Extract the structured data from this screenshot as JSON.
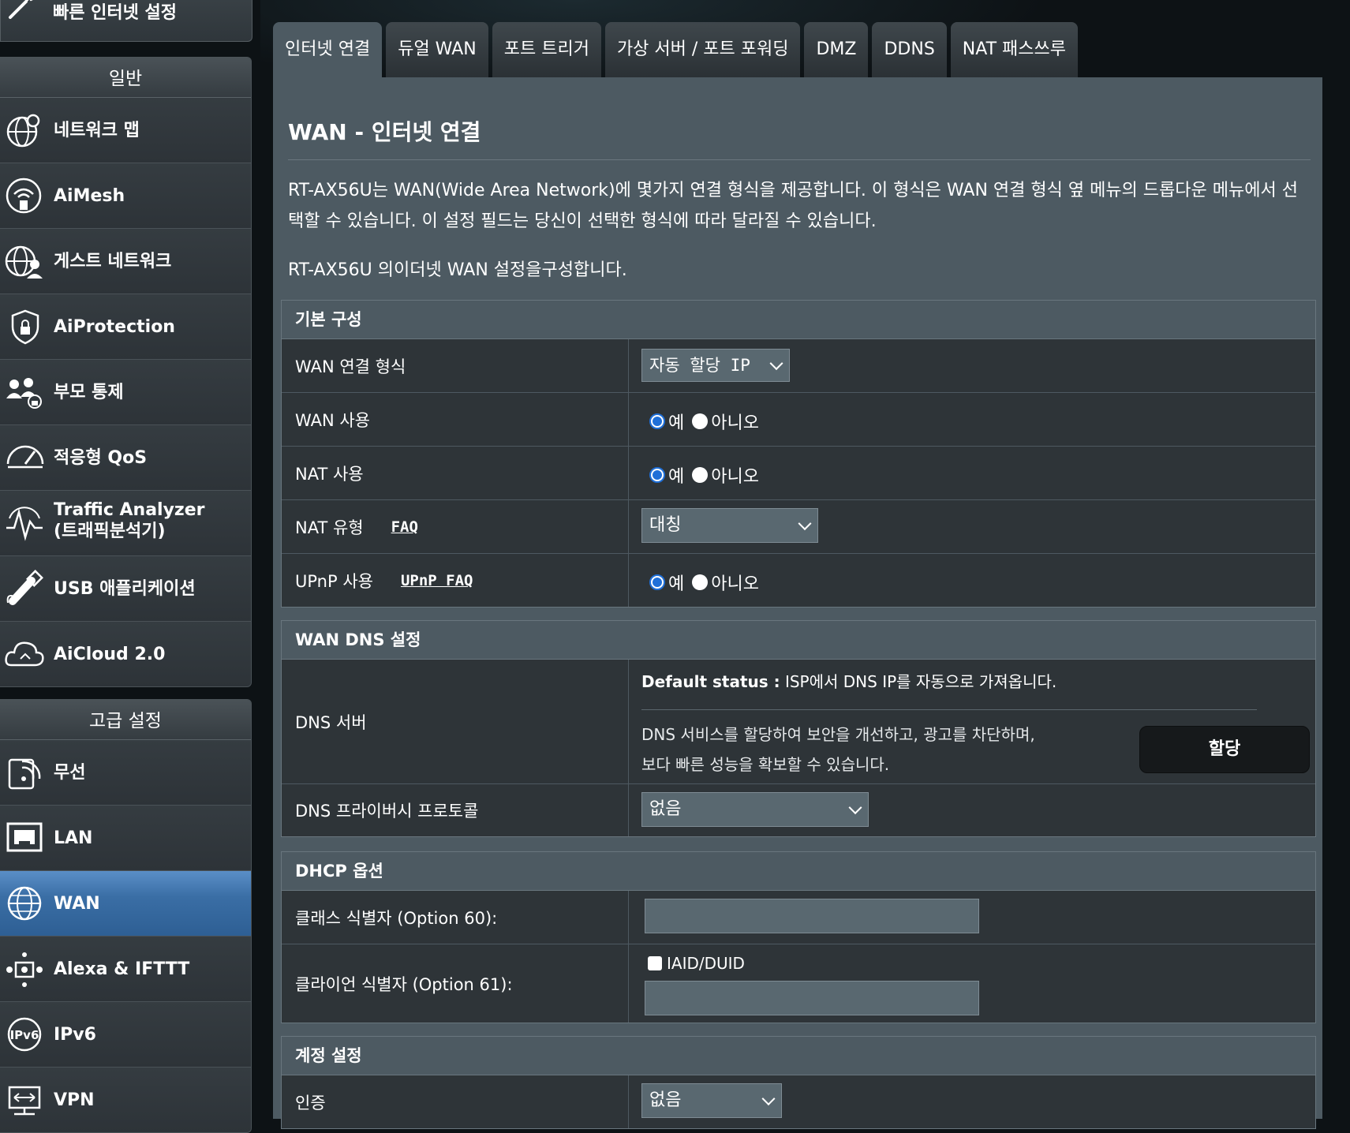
{
  "sidebar": {
    "quick_setup": "빠른 인터넷 설정",
    "general_header": "일반",
    "general_items": [
      {
        "label": "네트워크 맵",
        "icon": "globe-pin-icon"
      },
      {
        "label": "AiMesh",
        "icon": "aimesh-icon"
      },
      {
        "label": "게스트 네트워크",
        "icon": "guest-network-icon"
      },
      {
        "label": "AiProtection",
        "icon": "shield-lock-icon"
      },
      {
        "label": "부모 통제",
        "icon": "parental-control-icon"
      },
      {
        "label": "적응형 QoS",
        "icon": "speedometer-icon"
      },
      {
        "label": "Traffic Analyzer",
        "label2": "(트래픽분석기)",
        "icon": "traffic-analyzer-icon"
      },
      {
        "label": "USB 애플리케이션",
        "icon": "usb-icon"
      },
      {
        "label": "AiCloud 2.0",
        "icon": "cloud-icon"
      }
    ],
    "advanced_header": "고급 설정",
    "advanced_items": [
      {
        "label": "무선",
        "icon": "wireless-icon"
      },
      {
        "label": "LAN",
        "icon": "lan-icon"
      },
      {
        "label": "WAN",
        "icon": "wan-globe-icon",
        "active": true
      },
      {
        "label": "Alexa & IFTTT",
        "icon": "alexa-icon"
      },
      {
        "label": "IPv6",
        "icon": "ipv6-icon"
      },
      {
        "label": "VPN",
        "icon": "vpn-icon"
      }
    ]
  },
  "tabs": [
    "인터넷 연결",
    "듀얼 WAN",
    "포트 트리거",
    "가상 서버 / 포트 포워딩",
    "DMZ",
    "DDNS",
    "NAT 패스쓰루"
  ],
  "page": {
    "title": "WAN - 인터넷 연결",
    "description": "RT-AX56U는 WAN(Wide Area Network)에 몇가지 연결 형식을 제공합니다. 이 형식은 WAN 연결 형식 옆 메뉴의 드롭다운 메뉴에서 선택할 수 있습니다. 이 설정 필드는 당신이 선택한 형식에 따라 달라질 수 있습니다.",
    "description2": "RT-AX56U 의이더넷 WAN 설정을구성합니다."
  },
  "basic": {
    "header": "기본 구성",
    "wan_type_label": "WAN 연결 형식",
    "wan_type_value": "자동 할당 IP",
    "wan_enable_label": "WAN 사용",
    "nat_enable_label": "NAT 사용",
    "nat_type_label": "NAT 유형",
    "nat_type_faq": "FAQ",
    "nat_type_value": "대칭",
    "upnp_label": "UPnP 사용",
    "upnp_faq": "UPnP FAQ",
    "yes": "예",
    "no": "아니오"
  },
  "dns": {
    "header": "WAN DNS 설정",
    "server_label": "DNS 서버",
    "default_status_label": "Default status :",
    "default_status_text": " ISP에서 DNS IP를 자동으로 가져옵니다.",
    "assign_desc_line1": "DNS 서비스를 할당하여 보안을 개선하고, 광고를 차단하며,",
    "assign_desc_line2": "보다 빠른 성능을 확보할 수 있습니다.",
    "assign_button": "할당",
    "privacy_label": "DNS 프라이버시 프로토콜",
    "privacy_value": "없음"
  },
  "dhcp": {
    "header": "DHCP 옵션",
    "class_id_label": "클래스 식별자 (Option 60):",
    "class_id_value": "",
    "client_id_label": "클라이언 식별자 (Option 61):",
    "iaid_label": "IAID/DUID",
    "client_id_value": ""
  },
  "account": {
    "header": "계정 설정",
    "auth_label": "인증",
    "auth_value": "없음"
  },
  "colors": {
    "active_menu": "#3a6ea5",
    "content_bg": "#4d5a62",
    "row_bg": "#2e3438",
    "radio_selected": "#1f6fd8"
  }
}
